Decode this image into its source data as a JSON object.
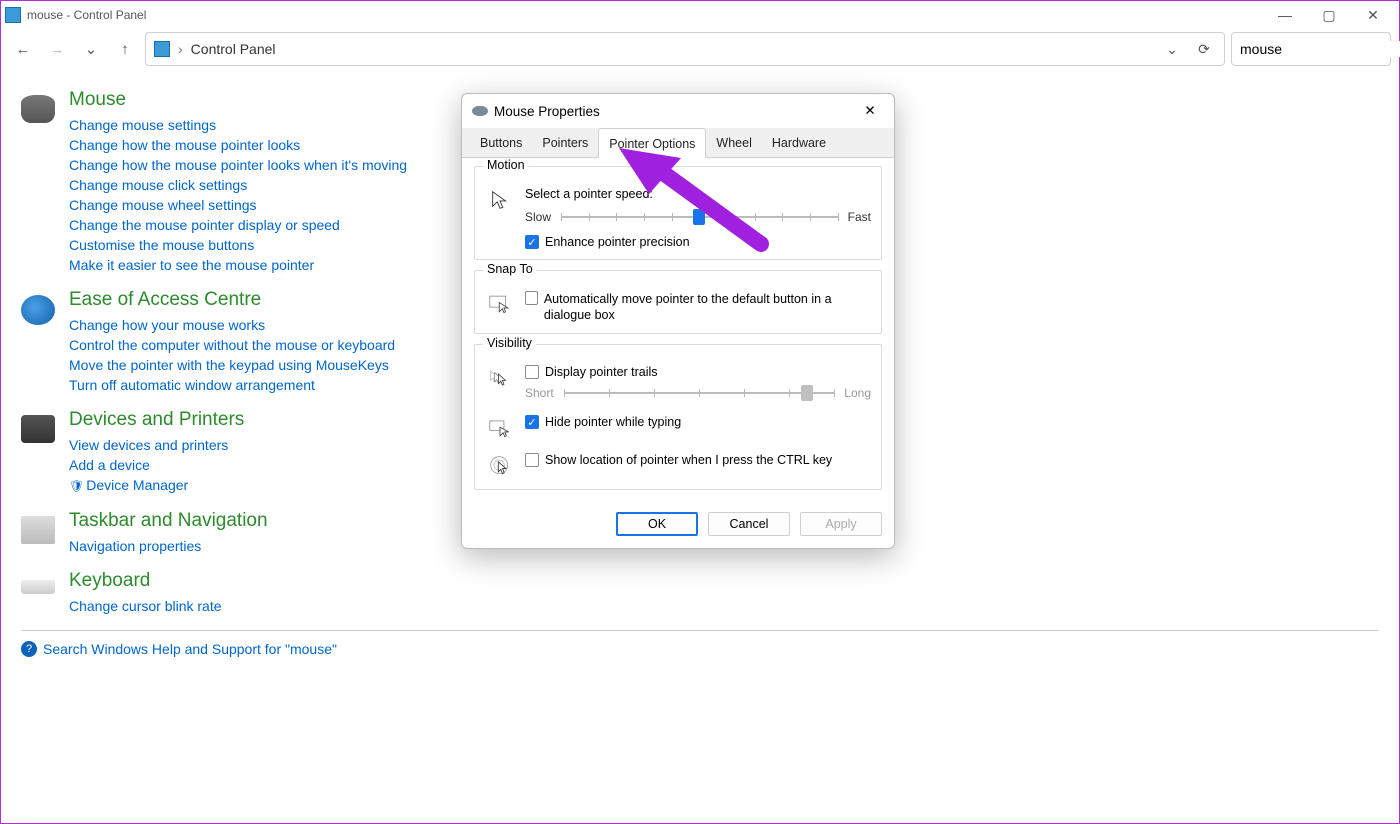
{
  "window": {
    "title": "mouse - Control Panel"
  },
  "toolbar": {
    "breadcrumb": "Control Panel",
    "search_value": "mouse"
  },
  "categories": [
    {
      "title": "Mouse",
      "icon_class": "mouse-ic",
      "links": [
        "Change mouse settings",
        "Change how the mouse pointer looks",
        "Change how the mouse pointer looks when it's moving",
        "Change mouse click settings",
        "Change mouse wheel settings",
        "Change the mouse pointer display or speed",
        "Customise the mouse buttons",
        "Make it easier to see the mouse pointer"
      ]
    },
    {
      "title": "Ease of Access Centre",
      "icon_class": "eoa-ic",
      "links": [
        "Change how your mouse works",
        "Control the computer without the mouse or keyboard",
        "Move the pointer with the keypad using MouseKeys",
        "Turn off automatic window arrangement"
      ]
    },
    {
      "title": "Devices and Printers",
      "icon_class": "dev-ic",
      "links": [
        "View devices and printers",
        "Add a device",
        "Device Manager"
      ],
      "shield_index": 2
    },
    {
      "title": "Taskbar and Navigation",
      "icon_class": "task-ic",
      "links": [
        "Navigation properties"
      ]
    },
    {
      "title": "Keyboard",
      "icon_class": "key-ic",
      "links": [
        "Change cursor blink rate"
      ]
    }
  ],
  "help_line": "Search Windows Help and Support for \"mouse\"",
  "dialog": {
    "title": "Mouse Properties",
    "tabs": [
      "Buttons",
      "Pointers",
      "Pointer Options",
      "Wheel",
      "Hardware"
    ],
    "active_tab": 2,
    "motion": {
      "legend": "Motion",
      "label": "Select a pointer speed:",
      "slow": "Slow",
      "fast": "Fast",
      "speed_percent": 50,
      "enhance_label": "Enhance pointer precision",
      "enhance_checked": true
    },
    "snap": {
      "legend": "Snap To",
      "label": "Automatically move pointer to the default button in a dialogue box",
      "checked": false
    },
    "visibility": {
      "legend": "Visibility",
      "trails_label": "Display pointer trails",
      "trails_checked": false,
      "short": "Short",
      "long": "Long",
      "trails_percent": 90,
      "hide_label": "Hide pointer while typing",
      "hide_checked": true,
      "ctrl_label": "Show location of pointer when I press the CTRL key",
      "ctrl_checked": false
    },
    "buttons": {
      "ok": "OK",
      "cancel": "Cancel",
      "apply": "Apply"
    }
  }
}
